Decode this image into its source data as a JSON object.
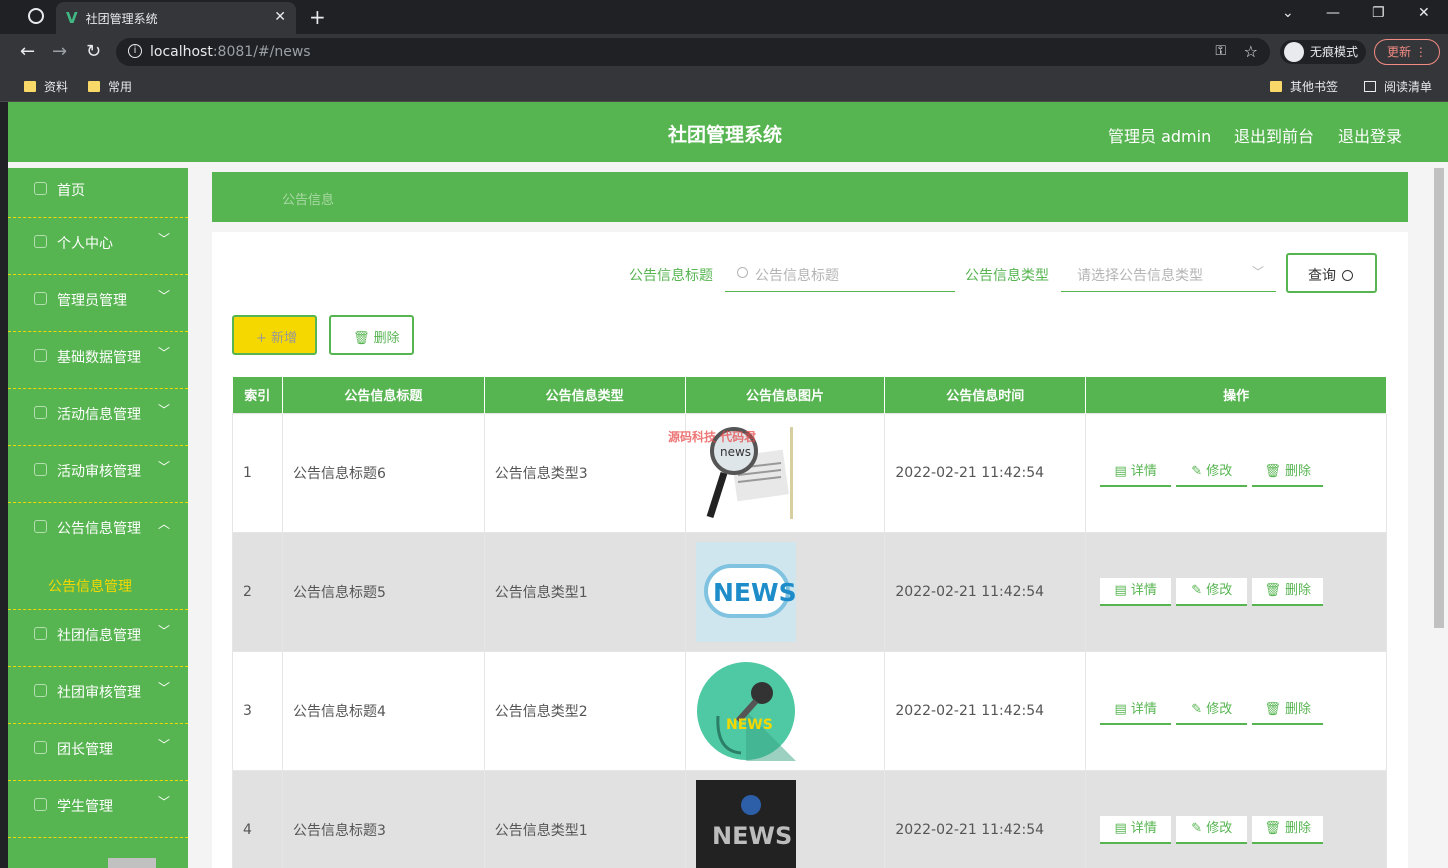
{
  "browser": {
    "tab_title": "社团管理系统",
    "tab_logo": "V",
    "url_host": "localhost",
    "url_rest": ":8081/#/news",
    "incognito_label": "无痕模式",
    "update_label": "更新",
    "bookmarks": [
      "资料",
      "常用"
    ],
    "bookmarks_right": [
      "其他书签",
      "阅读清单"
    ]
  },
  "header": {
    "title": "社团管理系统",
    "user": "管理员 admin",
    "to_front": "退出到前台",
    "logout": "退出登录"
  },
  "sidebar": {
    "items": [
      {
        "label": "首页",
        "icon": "home-icon"
      },
      {
        "label": "个人中心",
        "icon": "user-icon"
      },
      {
        "label": "管理员管理",
        "icon": "admin-icon"
      },
      {
        "label": "基础数据管理",
        "icon": "data-icon"
      },
      {
        "label": "活动信息管理",
        "icon": "activity-icon"
      },
      {
        "label": "活动审核管理",
        "icon": "audit-icon"
      },
      {
        "label": "公告信息管理",
        "icon": "notice-icon"
      },
      {
        "label": "社团信息管理",
        "icon": "club-icon"
      },
      {
        "label": "社团审核管理",
        "icon": "club-audit-icon"
      },
      {
        "label": "团长管理",
        "icon": "leader-icon"
      },
      {
        "label": "学生管理",
        "icon": "student-icon"
      }
    ],
    "active_sub": "公告信息管理"
  },
  "breadcrumb": "公告信息",
  "search": {
    "title_label": "公告信息标题",
    "title_placeholder": "公告信息标题",
    "type_label": "公告信息类型",
    "type_placeholder": "请选择公告信息类型",
    "query_label": "查询"
  },
  "actions": {
    "add": "新增",
    "delete": "删除"
  },
  "table": {
    "columns": [
      "索引",
      "公告信息标题",
      "公告信息类型",
      "公告信息图片",
      "公告信息时间",
      "操作"
    ],
    "rows": [
      {
        "index": "1",
        "title": "公告信息标题6",
        "type": "公告信息类型3",
        "time": "2022-02-21 11:42:54"
      },
      {
        "index": "2",
        "title": "公告信息标题5",
        "type": "公告信息类型1",
        "time": "2022-02-21 11:42:54"
      },
      {
        "index": "3",
        "title": "公告信息标题4",
        "type": "公告信息类型2",
        "time": "2022-02-21 11:42:54"
      },
      {
        "index": "4",
        "title": "公告信息标题3",
        "type": "公告信息类型1",
        "time": "2022-02-21 11:42:54"
      }
    ],
    "row_buttons": {
      "detail": "详情",
      "edit": "修改",
      "delete": "删除"
    },
    "image_texts": [
      "news",
      "NEWS",
      "NEWS",
      "NEWS"
    ]
  },
  "watermark": "源码科技 代码君",
  "colors": {
    "primary": "#57b551",
    "accent": "#f5d800"
  }
}
